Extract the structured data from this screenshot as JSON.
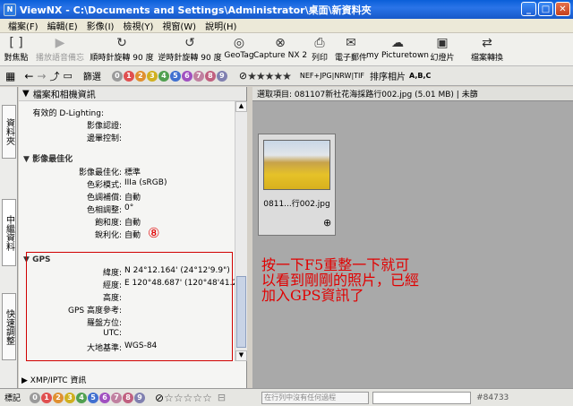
{
  "window": {
    "app": "ViewNX",
    "path": "C:\\Documents and Settings\\Administrator\\桌面\\新資料夾"
  },
  "menu": [
    "檔案(F)",
    "編輯(E)",
    "影像(I)",
    "檢視(Y)",
    "視窗(W)",
    "說明(H)"
  ],
  "toolbar": [
    {
      "label": "對焦點",
      "icon": "focus-icon",
      "enabled": true
    },
    {
      "label": "播放語音備忘",
      "icon": "play-memo-icon",
      "enabled": false
    },
    {
      "label": "順時針旋轉 90 度",
      "icon": "rotate-cw-icon",
      "enabled": true
    },
    {
      "label": "逆時針旋轉 90 度",
      "icon": "rotate-ccw-icon",
      "enabled": true
    },
    {
      "label": "GeoTag",
      "icon": "globe-icon",
      "enabled": true
    },
    {
      "label": "Capture NX 2",
      "icon": "capture-nx-icon",
      "enabled": true
    },
    {
      "label": "列印",
      "icon": "print-icon",
      "enabled": true
    },
    {
      "label": "電子郵件",
      "icon": "mail-icon",
      "enabled": true
    },
    {
      "label": "my Picturetown",
      "icon": "picturetown-icon",
      "enabled": true
    },
    {
      "label": "幻燈片",
      "icon": "slideshow-icon",
      "enabled": true
    },
    {
      "label": "檔案轉換",
      "icon": "convert-icon",
      "enabled": true
    }
  ],
  "toolbar2": {
    "select_label": "篩選",
    "filter_nums": [
      "0",
      "1",
      "2",
      "3",
      "4",
      "5",
      "6",
      "7",
      "8",
      "9"
    ],
    "stars": "★★★★★",
    "format_filter": "NEF+JPG|NRW|TIF",
    "sort_label": "排序相片",
    "sort_icon": "A,B,C"
  },
  "sidetabs": [
    "資料夾",
    "中繼資料",
    "快速調整"
  ],
  "leftpanel": {
    "header": "檔案和相機資訊",
    "rows_top": [
      {
        "label": "有效的 D-Lighting:",
        "value": ""
      },
      {
        "label": "影像認證:",
        "value": ""
      },
      {
        "label": "邊暈控制:",
        "value": ""
      }
    ],
    "section_image": "影像最佳化",
    "rows_image": [
      {
        "label": "影像最佳化:",
        "value": "標準"
      },
      {
        "label": "色彩模式:",
        "value": "IIIa (sRGB)"
      },
      {
        "label": "色調補償:",
        "value": "自動"
      },
      {
        "label": "色相調整:",
        "value": "0°"
      },
      {
        "label": "飽和度:",
        "value": "自動"
      },
      {
        "label": "銳利化:",
        "value": "自動"
      }
    ],
    "badge": "⑧",
    "section_gps": "GPS",
    "rows_gps": [
      {
        "label": "緯度:",
        "value": "N 24°12.164' (24°12'9.9\")"
      },
      {
        "label": "經度:",
        "value": "E 120°48.687' (120°48'41.2\")"
      },
      {
        "label": "高度:",
        "value": ""
      },
      {
        "label": "GPS 高度參考:",
        "value": ""
      },
      {
        "label": "羅盤方位:",
        "value": ""
      },
      {
        "label": "UTC:",
        "value": ""
      },
      {
        "label": "大地基準:",
        "value": "WGS-84"
      }
    ],
    "footer": "XMP/IPTC 資訊"
  },
  "rightpanel": {
    "status": "選取項目: 081107新社花海採路行002.jpg (5.01 MB) | 未篩",
    "thumb_label": "0811...行002.jpg",
    "annotation": "按一下F5重整一下就可以看到剛剛的照片，已經加入GPS資訊了"
  },
  "bottombar": {
    "label": "標記",
    "search_placeholder": "在行列中沒有任何過程",
    "id": "#84733"
  },
  "colors": {
    "title": "#1c63d8",
    "annotation": "#e10000",
    "redbox": "#d00000"
  }
}
